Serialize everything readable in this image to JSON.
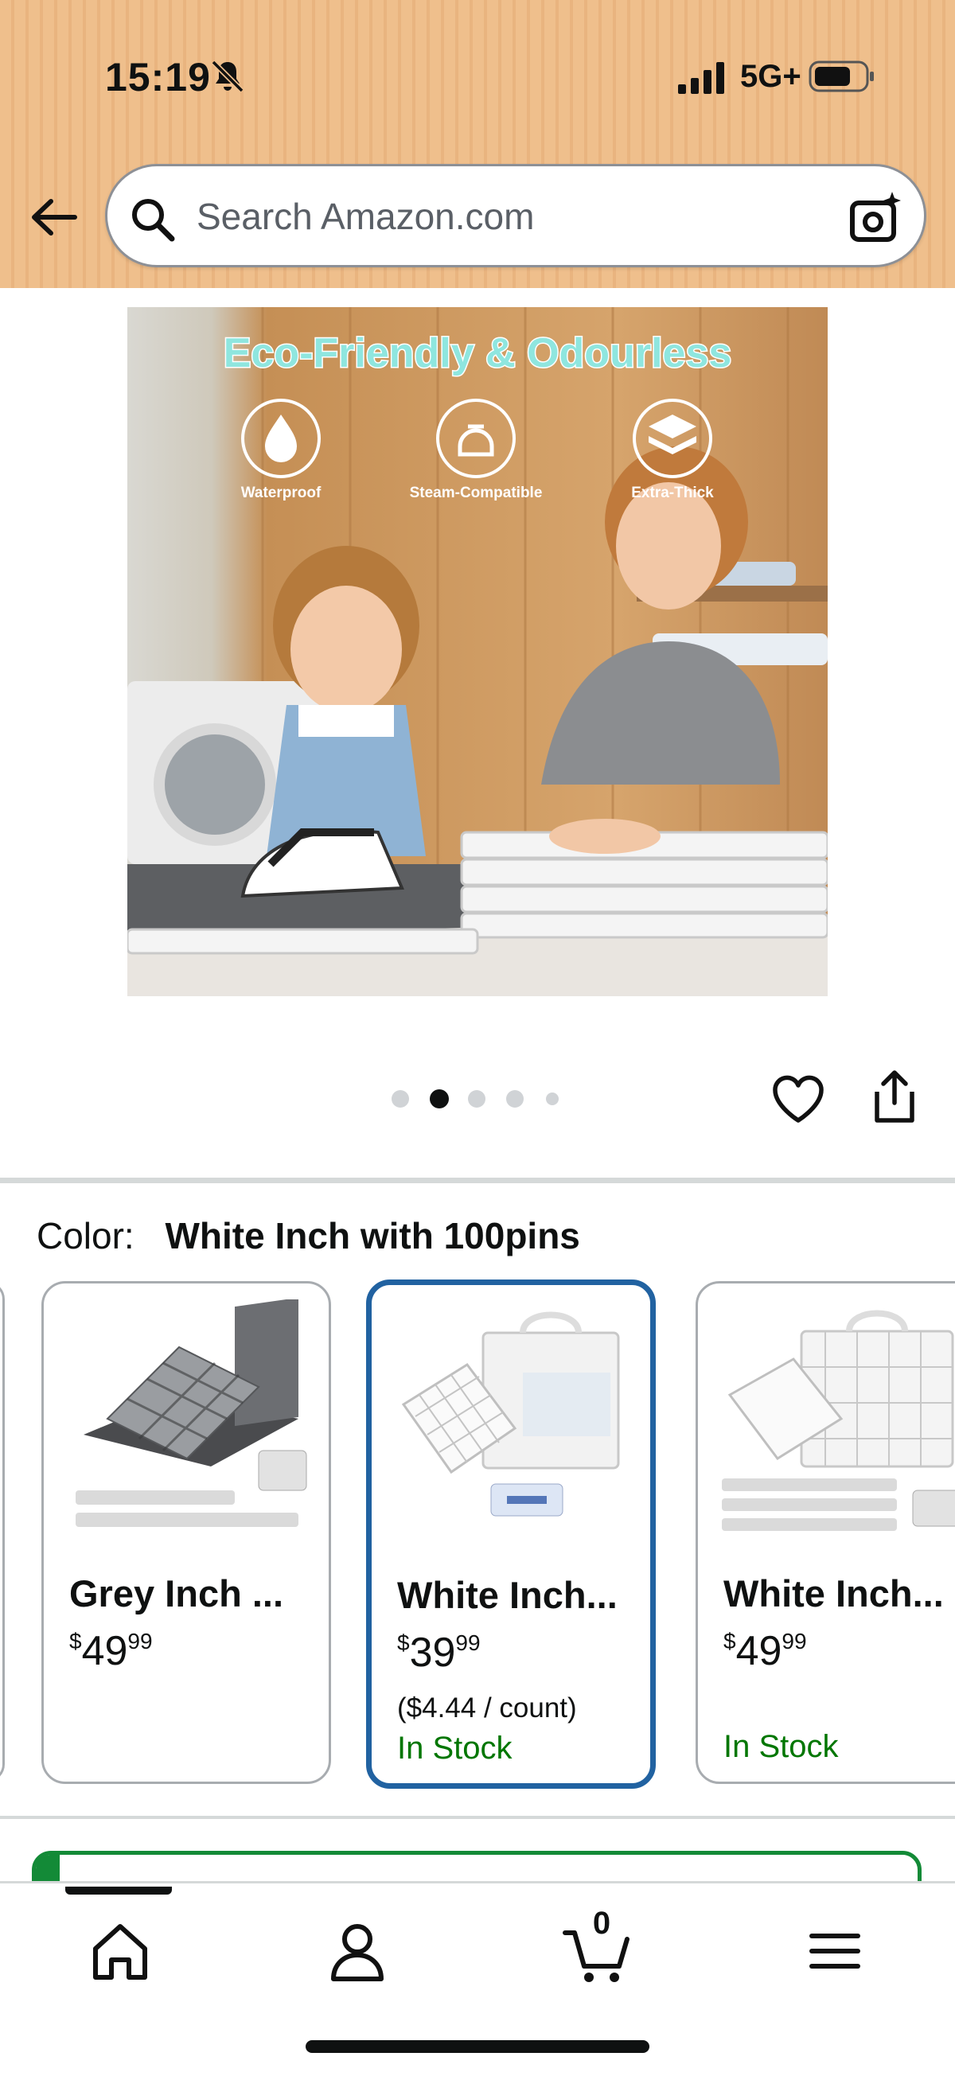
{
  "status_bar": {
    "time": "15:19",
    "network": "5G+",
    "icons": [
      "bell-slash-icon",
      "signal-icon",
      "battery-icon"
    ]
  },
  "header": {
    "search_placeholder": "Search Amazon.com",
    "icons": [
      "back-arrow-icon",
      "search-icon",
      "camera-icon"
    ]
  },
  "hero": {
    "title": "Eco-Friendly & Odourless",
    "features": [
      "Waterproof",
      "Steam-Compatible",
      "Extra-Thick"
    ],
    "carousel_total": 5,
    "carousel_active": 2
  },
  "color": {
    "label": "Color:",
    "value": "White Inch with 100pins"
  },
  "variants": [
    {
      "title": "Grey Inch ...",
      "price_symbol": "$",
      "price_whole": "49",
      "price_fraction": "99",
      "unit_price": "",
      "stock": "",
      "selected": false
    },
    {
      "title": "White Inch...",
      "price_symbol": "$",
      "price_whole": "39",
      "price_fraction": "99",
      "unit_price": "($4.44 / count)",
      "stock": "In Stock",
      "selected": true
    },
    {
      "title": "White Inch...",
      "price_symbol": "$",
      "price_whole": "49",
      "price_fraction": "99",
      "unit_price": "",
      "stock": "In Stock",
      "selected": false
    }
  ],
  "bottom_nav": {
    "items": [
      "home-icon",
      "account-icon",
      "cart-icon",
      "menu-icon"
    ],
    "cart_count": "0",
    "active": "home-icon"
  },
  "colors": {
    "header_bg": "#efbf8c",
    "selected_border": "#2162a1",
    "in_stock": "#007600",
    "text": "#0f1111"
  }
}
